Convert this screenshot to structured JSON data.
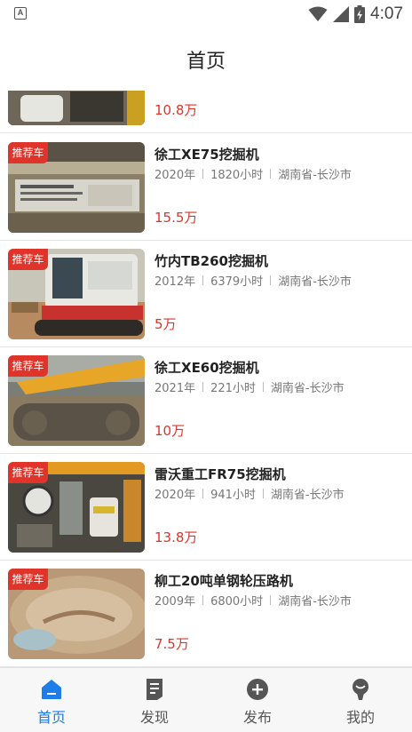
{
  "status_bar": {
    "time": "4:07",
    "notification_icon": "a-icon",
    "icons": [
      "wifi-icon",
      "signal-icon",
      "battery-charging-icon"
    ]
  },
  "header": {
    "title": "首页"
  },
  "colors": {
    "accent": "#1e7de6",
    "price": "#e0342a",
    "badge": "#e0342a"
  },
  "listings": [
    {
      "price": "10.8万",
      "partial": true
    },
    {
      "badge": "推荐车",
      "title": "徐工XE75挖掘机",
      "year": "2020年",
      "hours": "1820小时",
      "location": "湖南省-长沙市",
      "price": "15.5万"
    },
    {
      "badge": "推荐车",
      "title": "竹内TB260挖掘机",
      "year": "2012年",
      "hours": "6379小时",
      "location": "湖南省-长沙市",
      "price": "5万"
    },
    {
      "badge": "推荐车",
      "title": "徐工XE60挖掘机",
      "year": "2021年",
      "hours": "221小时",
      "location": "湖南省-长沙市",
      "price": "10万"
    },
    {
      "badge": "推荐车",
      "title": "雷沃重工FR75挖掘机",
      "year": "2020年",
      "hours": "941小时",
      "location": "湖南省-长沙市",
      "price": "13.8万"
    },
    {
      "badge": "推荐车",
      "title": "柳工20吨单钢轮压路机",
      "year": "2009年",
      "hours": "6800小时",
      "location": "湖南省-长沙市",
      "price": "7.5万"
    }
  ],
  "bottom_nav": [
    {
      "label": "首页",
      "icon": "home-icon",
      "active": true
    },
    {
      "label": "发现",
      "icon": "discover-icon",
      "active": false
    },
    {
      "label": "发布",
      "icon": "publish-icon",
      "active": false
    },
    {
      "label": "我的",
      "icon": "profile-icon",
      "active": false
    }
  ]
}
